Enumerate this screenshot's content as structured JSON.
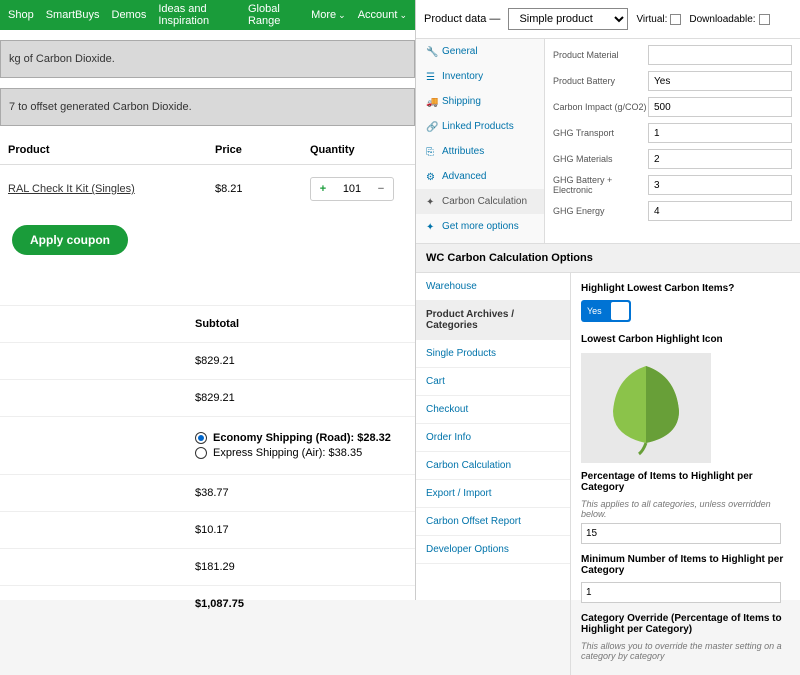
{
  "nav": [
    "Shop",
    "SmartBuys",
    "Demos",
    "Ideas and Inspiration",
    "Global Range",
    "More",
    "Account"
  ],
  "banner1": "kg of Carbon Dioxide.",
  "banner2": "7 to offset generated Carbon Dioxide.",
  "headers": {
    "product": "Product",
    "price": "Price",
    "qty": "Quantity"
  },
  "item": {
    "name": "RAL Check It Kit (Singles)",
    "price": "$8.21",
    "qty": "101"
  },
  "coupon": "Apply coupon",
  "subtotal_label": "Subtotal",
  "totals": [
    "$829.21",
    "$829.21"
  ],
  "ship1": "Economy Shipping (Road): $28.32",
  "ship2": "Express Shipping (Air): $38.35",
  "totals2": [
    "$38.77",
    "$10.17",
    "$181.29",
    "$1,087.75"
  ],
  "pd": {
    "label": "Product data —",
    "type": "Simple product",
    "virtual": "Virtual:",
    "download": "Downloadable:"
  },
  "tabs": [
    "General",
    "Inventory",
    "Shipping",
    "Linked Products",
    "Attributes",
    "Advanced",
    "Carbon Calculation",
    "Get more options"
  ],
  "fields": [
    {
      "l": "Product Material",
      "v": ""
    },
    {
      "l": "Product Battery",
      "v": "Yes"
    },
    {
      "l": "Carbon Impact (g/CO2)",
      "v": "500"
    },
    {
      "l": "GHG Transport",
      "v": "1"
    },
    {
      "l": "GHG Materials",
      "v": "2"
    },
    {
      "l": "GHG Battery + Electronic",
      "v": "3"
    },
    {
      "l": "GHG Energy",
      "v": "4"
    }
  ],
  "opt_header": "WC Carbon Calculation Options",
  "opt_tabs": [
    "Warehouse",
    "Product Archives / Categories",
    "Single Products",
    "Cart",
    "Checkout",
    "Order Info",
    "Carbon Calculation",
    "Export / Import",
    "Carbon Offset Report",
    "Developer Options"
  ],
  "highlight": {
    "label": "Highlight Lowest Carbon Items?",
    "yes": "Yes"
  },
  "icon_label": "Lowest Carbon Highlight Icon",
  "pct": {
    "label": "Percentage of Items to Highlight per Category",
    "help": "This applies to all categories, unless overridden below.",
    "val": "15"
  },
  "min": {
    "label": "Minimum Number of Items to Highlight per Category",
    "val": "1"
  },
  "override": {
    "label": "Category Override (Percentage of Items to Highlight per Category)",
    "help": "This allows you to override the master setting on a category by category"
  }
}
